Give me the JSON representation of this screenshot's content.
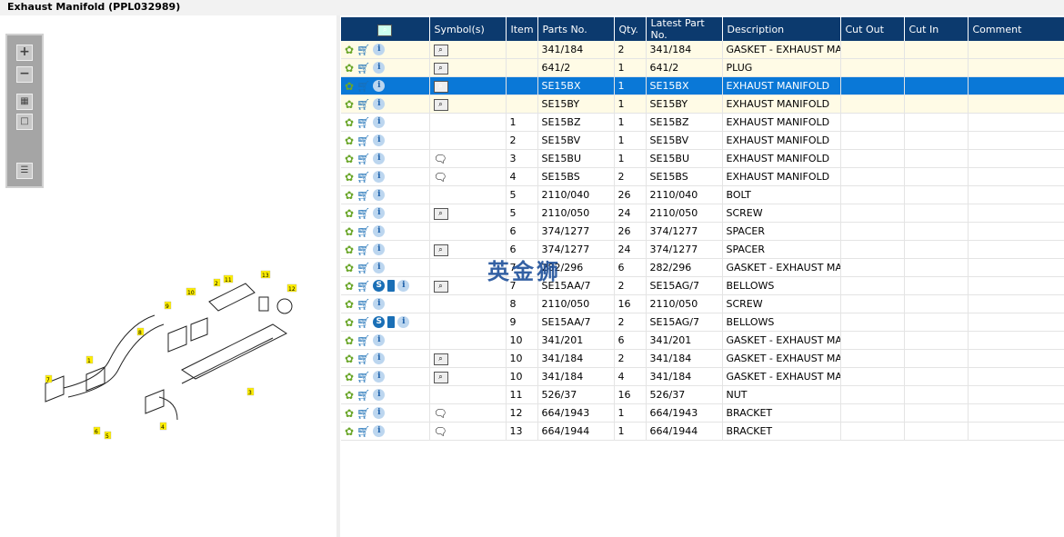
{
  "title": "Exhaust Manifold (PPL032989)",
  "toolbar": [
    "zoom-in",
    "zoom-out",
    "fit-all",
    "actual-size",
    "toggle-panel"
  ],
  "columns": [
    "",
    "Symbol(s)",
    "Item",
    "Parts No.",
    "Qty.",
    "Latest Part No.",
    "Description",
    "Cut Out",
    "Cut In",
    "Comment"
  ],
  "rows": [
    {
      "s": "book-search",
      "item": "",
      "part": "341/184",
      "qty": "2",
      "latest": "341/184",
      "desc": "GASKET - EXHAUST MANI",
      "style": "y"
    },
    {
      "s": "book-search",
      "item": "",
      "part": "641/2",
      "qty": "1",
      "latest": "641/2",
      "desc": "PLUG",
      "style": "y"
    },
    {
      "s": "book-search",
      "item": "",
      "part": "SE15BX",
      "qty": "1",
      "latest": "SE15BX",
      "desc": "EXHAUST MANIFOLD",
      "style": "sel"
    },
    {
      "s": "book-search",
      "item": "",
      "part": "SE15BY",
      "qty": "1",
      "latest": "SE15BY",
      "desc": "EXHAUST MANIFOLD",
      "style": "y"
    },
    {
      "s": "",
      "item": "1",
      "part": "SE15BZ",
      "qty": "1",
      "latest": "SE15BZ",
      "desc": "EXHAUST MANIFOLD"
    },
    {
      "s": "",
      "item": "2",
      "part": "SE15BV",
      "qty": "1",
      "latest": "SE15BV",
      "desc": "EXHAUST MANIFOLD"
    },
    {
      "s": "comment",
      "item": "3",
      "part": "SE15BU",
      "qty": "1",
      "latest": "SE15BU",
      "desc": "EXHAUST MANIFOLD"
    },
    {
      "s": "comment",
      "item": "4",
      "part": "SE15BS",
      "qty": "2",
      "latest": "SE15BS",
      "desc": "EXHAUST MANIFOLD"
    },
    {
      "s": "",
      "item": "5",
      "part": "2110/040",
      "qty": "26",
      "latest": "2110/040",
      "desc": "BOLT"
    },
    {
      "s": "book-search",
      "item": "5",
      "part": "2110/050",
      "qty": "24",
      "latest": "2110/050",
      "desc": "SCREW"
    },
    {
      "s": "",
      "item": "6",
      "part": "374/1277",
      "qty": "26",
      "latest": "374/1277",
      "desc": "SPACER"
    },
    {
      "s": "book-search",
      "item": "6",
      "part": "374/1277",
      "qty": "24",
      "latest": "374/1277",
      "desc": "SPACER"
    },
    {
      "s": "",
      "item": "7",
      "part": "282/296",
      "qty": "6",
      "latest": "282/296",
      "desc": "GASKET - EXHAUST MANI"
    },
    {
      "s": "book-search",
      "item": "7",
      "part": "SE15AA/7",
      "qty": "2",
      "latest": "SE15AG/7",
      "desc": "BELLOWS",
      "extra": true
    },
    {
      "s": "",
      "item": "8",
      "part": "2110/050",
      "qty": "16",
      "latest": "2110/050",
      "desc": "SCREW"
    },
    {
      "s": "",
      "item": "9",
      "part": "SE15AA/7",
      "qty": "2",
      "latest": "SE15AG/7",
      "desc": "BELLOWS",
      "extra": true
    },
    {
      "s": "",
      "item": "10",
      "part": "341/201",
      "qty": "6",
      "latest": "341/201",
      "desc": "GASKET - EXHAUST MANI"
    },
    {
      "s": "book-search",
      "item": "10",
      "part": "341/184",
      "qty": "2",
      "latest": "341/184",
      "desc": "GASKET - EXHAUST MANI"
    },
    {
      "s": "book-search",
      "item": "10",
      "part": "341/184",
      "qty": "4",
      "latest": "341/184",
      "desc": "GASKET - EXHAUST MANI"
    },
    {
      "s": "",
      "item": "11",
      "part": "526/37",
      "qty": "16",
      "latest": "526/37",
      "desc": "NUT"
    },
    {
      "s": "comment",
      "item": "12",
      "part": "664/1943",
      "qty": "1",
      "latest": "664/1943",
      "desc": "BRACKET"
    },
    {
      "s": "comment",
      "item": "13",
      "part": "664/1944",
      "qty": "1",
      "latest": "664/1944",
      "desc": "BRACKET"
    }
  ],
  "diagram_labels": [
    "1",
    "2",
    "3",
    "4",
    "5",
    "6",
    "7",
    "8",
    "9",
    "10",
    "11",
    "12",
    "13"
  ],
  "watermark": "英金狮"
}
